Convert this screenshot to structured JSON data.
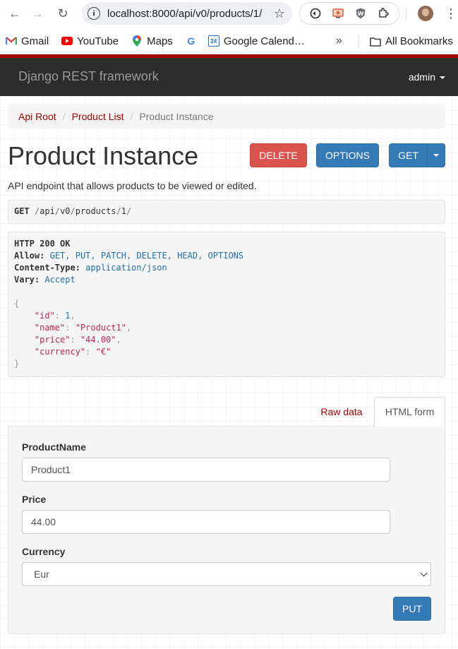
{
  "browser": {
    "url": "localhost:8000/api/v0/products/1/",
    "bookmarks": [
      {
        "label": "Gmail",
        "icon": "gmail-icon",
        "color": "#ea4335"
      },
      {
        "label": "YouTube",
        "icon": "youtube-icon",
        "color": "#ff0000"
      },
      {
        "label": "Maps",
        "icon": "maps-icon",
        "color": "#34a853"
      },
      {
        "label": "",
        "icon": "google-icon",
        "color": "#4285f4"
      },
      {
        "label": "Google Calend…",
        "icon": "calendar-icon",
        "color": "#1a73e8"
      }
    ],
    "more_symbol": "»",
    "all_bookmarks": "All Bookmarks",
    "calendar_number": "24"
  },
  "navbar": {
    "brand": "Django REST framework",
    "user": "admin",
    "bg_color": "#2c2c2c",
    "accent_color": "#a30000"
  },
  "breadcrumb": {
    "items": [
      "Api Root",
      "Product List",
      "Product Instance"
    ],
    "separator": "/"
  },
  "page": {
    "title": "Product Instance",
    "description": "API endpoint that allows products to be viewed or edited."
  },
  "actions": {
    "delete": "DELETE",
    "options": "OPTIONS",
    "get": "GET"
  },
  "request": {
    "method": "GET",
    "path_parts": [
      "/",
      "api",
      "/",
      "v0",
      "/",
      "products",
      "/",
      "1",
      "/"
    ]
  },
  "response": {
    "status": "HTTP 200 OK",
    "headers": [
      {
        "name": "Allow:",
        "value": "GET, PUT, PATCH, DELETE, HEAD, OPTIONS"
      },
      {
        "name": "Content-Type:",
        "value": "application/json"
      },
      {
        "name": "Vary:",
        "value": "Accept"
      }
    ],
    "body": {
      "open": "{",
      "close": "}",
      "fields": [
        {
          "key": "\"id\"",
          "value": "1",
          "type": "num",
          "comma": ","
        },
        {
          "key": "\"name\"",
          "value": "\"Product1\"",
          "type": "str",
          "comma": ","
        },
        {
          "key": "\"price\"",
          "value": "\"44.00\"",
          "type": "str",
          "comma": ","
        },
        {
          "key": "\"currency\"",
          "value": "\"€\"",
          "type": "str",
          "comma": ""
        }
      ]
    }
  },
  "form_tabs": {
    "raw": "Raw data",
    "html": "HTML form"
  },
  "form": {
    "fields": [
      {
        "label": "ProductName",
        "value": "Product1"
      },
      {
        "label": "Price",
        "value": "44.00"
      }
    ],
    "currency_label": "Currency",
    "currency_value": "Eur",
    "submit": "PUT"
  }
}
